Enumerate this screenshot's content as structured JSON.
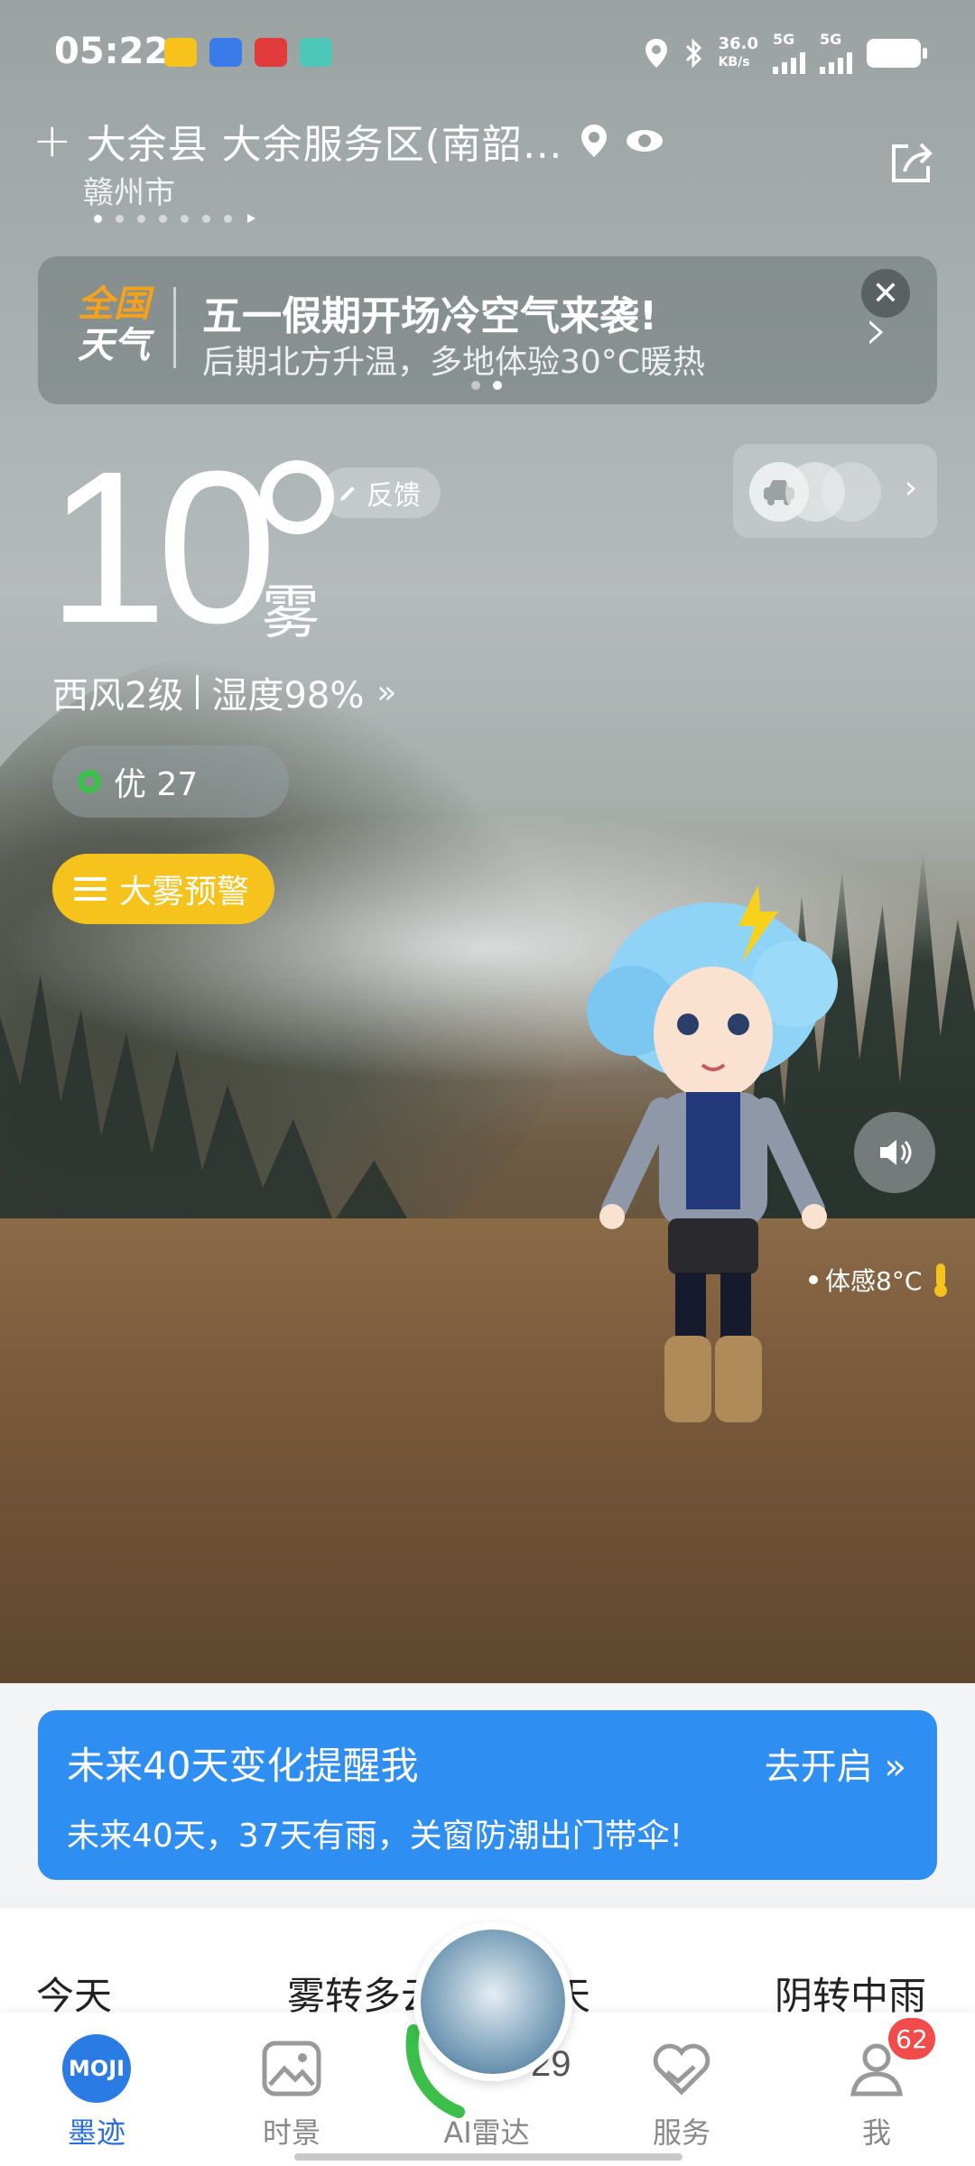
{
  "status_bar": {
    "time": "05:22",
    "net_speed_value": "36.0",
    "net_speed_unit": "KB/s",
    "sim1": "5G",
    "sim2": "5G"
  },
  "header": {
    "location": "大余县 大余服务区(南韶…",
    "city": "赣州市"
  },
  "banner": {
    "logo_line1": "全国",
    "logo_line2": "天气",
    "title": "五一假期开场冷空气来袭!",
    "subtitle": "后期北方升温，多地体验30°C暖热"
  },
  "current": {
    "temperature": "10",
    "condition": "雾",
    "feedback_label": "反馈",
    "wind": "西风2级",
    "humidity": "湿度98%",
    "aqi_label": "优 27",
    "warning_label": "大雾预警",
    "feels_like": "体感8°C"
  },
  "reminder": {
    "title": "未来40天变化提醒我",
    "action": "去开启",
    "subtitle": "未来40天，37天有雨，关窗防潮出门带伞!"
  },
  "forecast": {
    "day1": "今天",
    "cond1": "雾转多云",
    "day2": "明天",
    "cond2": "阴转中雨",
    "partial_value": "29"
  },
  "tabbar": {
    "tabs": [
      "墨迹",
      "时景",
      "AI雷达",
      "服务",
      "我"
    ],
    "me_badge": "62",
    "moji_logo": "MOJI"
  },
  "colors": {
    "accent_blue": "#2f8ef2",
    "warning_yellow": "#f6c21c",
    "aqi_green": "#3bbf4a",
    "banner_orange": "#f5a11a",
    "badge_red": "#f14b4b"
  }
}
